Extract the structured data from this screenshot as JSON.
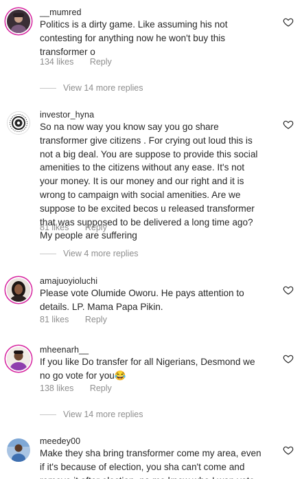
{
  "comments": [
    {
      "username": "__mumred",
      "text": "Politics is a dirty game. Like assuming his not\ncontesting for anything now he won't buy this\ntransformer o",
      "likes": "134 likes",
      "reply_label": "Reply",
      "view_replies": "View 14 more replies",
      "avatar_icon": "profile-photo"
    },
    {
      "username": "investor_hyna",
      "text": "So na now way you know say you go share\ntransformer give citizens . For crying out loud this is\nnot a big deal. You are suppose to provide this social\namenities to the citizens without any ease. It's not\nyour money. It is our money and our right and it is\nwrong to campaign with social amenities. Are we\nsuppose to be excited becos u released transformer\nthat was supposed to be delivered a long time ago?\nMy people are suffering",
      "likes": "81 likes",
      "reply_label": "Reply",
      "view_replies": "View 4 more replies",
      "avatar_icon": "logo-avatar"
    },
    {
      "username": "amajuoyioluchi",
      "text": "Please vote Olumide Oworu. He pays attention to\ndetails. LP. Mama Papa Pikin.",
      "likes": "81 likes",
      "reply_label": "Reply",
      "avatar_icon": "profile-photo"
    },
    {
      "username": "mheenarh__",
      "text": "If you like Do transfer for all Nigerians, Desmond we\nno go vote for you😂",
      "likes": "138 likes",
      "reply_label": "Reply",
      "view_replies": "View 14 more replies",
      "avatar_icon": "profile-photo"
    },
    {
      "username": "meedey00",
      "text": "Make they sha bring transformer come my area, even\nif it's because of election, you sha can't come and\nremove it after election, na me know who I wan vote",
      "avatar_icon": "profile-photo"
    }
  ],
  "colors": {
    "text": "#262626",
    "secondary": "#8e8e8e",
    "story_ring": "#d6249f"
  }
}
